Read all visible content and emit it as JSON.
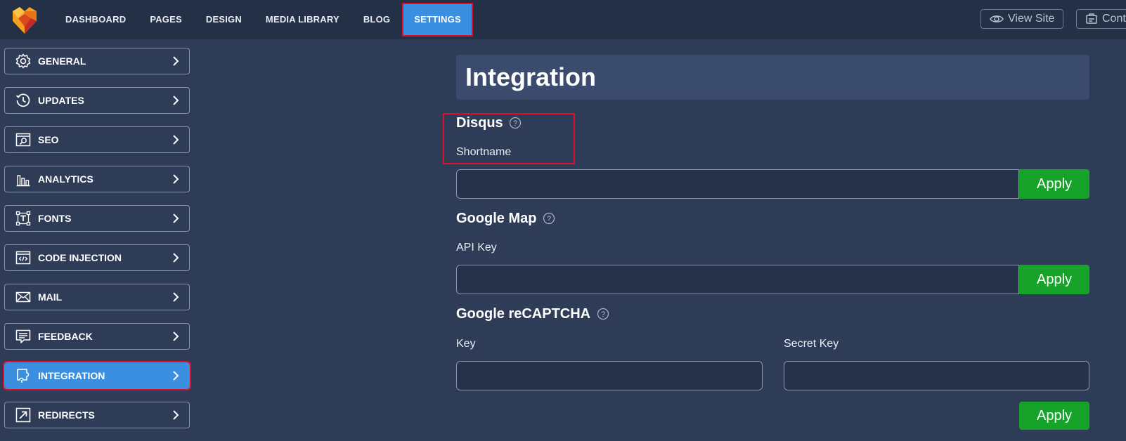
{
  "topnav": {
    "items": [
      {
        "label": "DASHBOARD"
      },
      {
        "label": "PAGES"
      },
      {
        "label": "DESIGN"
      },
      {
        "label": "MEDIA LIBRARY"
      },
      {
        "label": "BLOG"
      },
      {
        "label": "SETTINGS",
        "active": true
      }
    ],
    "view_site_label": "View Site",
    "content_label": "Cont"
  },
  "sidebar": {
    "items": [
      {
        "label": "GENERAL",
        "icon": "gear-icon"
      },
      {
        "label": "UPDATES",
        "icon": "history-icon"
      },
      {
        "label": "SEO",
        "icon": "seo-icon"
      },
      {
        "label": "ANALYTICS",
        "icon": "analytics-icon"
      },
      {
        "label": "FONTS",
        "icon": "fonts-icon"
      },
      {
        "label": "CODE INJECTION",
        "icon": "code-icon"
      },
      {
        "label": "MAIL",
        "icon": "mail-icon"
      },
      {
        "label": "FEEDBACK",
        "icon": "feedback-icon"
      },
      {
        "label": "INTEGRATION",
        "icon": "integration-icon",
        "active": true
      },
      {
        "label": "REDIRECTS",
        "icon": "redirect-icon"
      }
    ]
  },
  "main": {
    "title": "Integration",
    "disqus": {
      "title": "Disqus",
      "field_label": "Shortname",
      "value": "",
      "apply_label": "Apply"
    },
    "google_map": {
      "title": "Google Map",
      "field_label": "API Key",
      "value": "",
      "apply_label": "Apply"
    },
    "recaptcha": {
      "title": "Google reCAPTCHA",
      "key_label": "Key",
      "secret_label": "Secret Key",
      "key_value": "",
      "secret_value": "",
      "apply_label": "Apply"
    }
  },
  "colors": {
    "background": "#2f3c57",
    "topbar": "#233046",
    "accent": "#3a8fe0",
    "apply_green": "#17a32a",
    "highlight_red": "#e0102a"
  }
}
